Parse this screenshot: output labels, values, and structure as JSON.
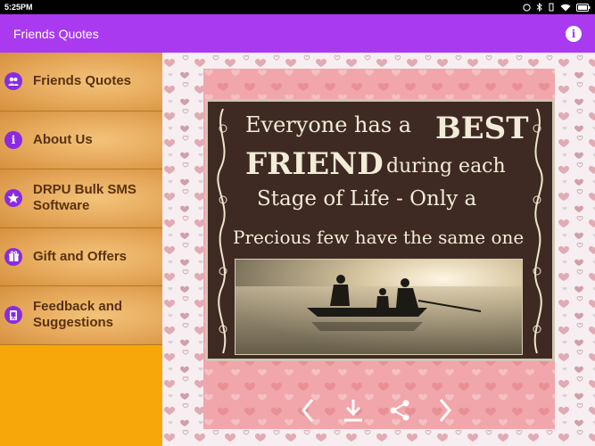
{
  "status_bar": {
    "time": "5:25PM"
  },
  "app_bar": {
    "title": "Friends Quotes"
  },
  "sidebar": {
    "items": [
      {
        "label": "Friends Quotes",
        "icon": "friends-icon"
      },
      {
        "label": "About Us",
        "icon": "info-icon"
      },
      {
        "label": "DRPU Bulk SMS Software",
        "icon": "star-icon"
      },
      {
        "label": "Gift and Offers",
        "icon": "gift-icon"
      },
      {
        "label": "Feedback and Suggestions",
        "icon": "feedback-icon"
      }
    ]
  },
  "quote": {
    "line1": "Everyone has a",
    "best": "BEST",
    "friend": "FRIEND",
    "during": "during each",
    "stage": "Stage of Life - Only a",
    "precious": "Precious few have the same one"
  },
  "controls": [
    "previous-icon",
    "download-icon",
    "share-icon",
    "next-icon"
  ],
  "colors": {
    "app_bar": "#a93af0",
    "sidebar": "#f8a70a",
    "menu_text": "#5a3110",
    "menu_icon": "#8a2be2",
    "quote_card": "#3e2a22",
    "panel": "#f0a6aa"
  }
}
